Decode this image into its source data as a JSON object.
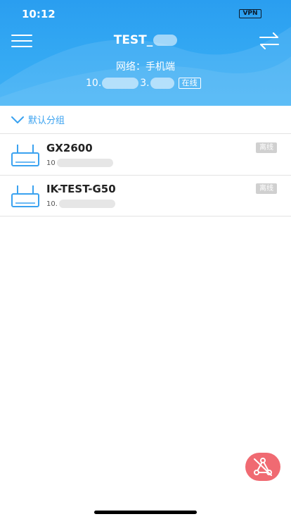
{
  "status_bar": {
    "time": "10:12",
    "vpn": "VPN"
  },
  "header": {
    "title": "TEST_",
    "network_label": "网络：手机端",
    "ip_prefix_1": "10.",
    "ip_prefix_2": "3.",
    "online_status": "在线",
    "menu_icon": "hamburger-menu-icon",
    "switch_icon": "swap-arrows-icon"
  },
  "group": {
    "label": "默认分组",
    "expanded": true
  },
  "devices": [
    {
      "name": "GX2600",
      "ip": "10",
      "status": "离线"
    },
    {
      "name": "IK-TEST-G50",
      "ip": "10.",
      "status": "离线"
    }
  ],
  "fab": {
    "icon": "network-topology-icon"
  },
  "colors": {
    "header_blue": "#34a9f3",
    "accent_blue": "#3aa2f0",
    "offline_gray": "#d0d0d0",
    "fab_red": "#f06a72"
  }
}
